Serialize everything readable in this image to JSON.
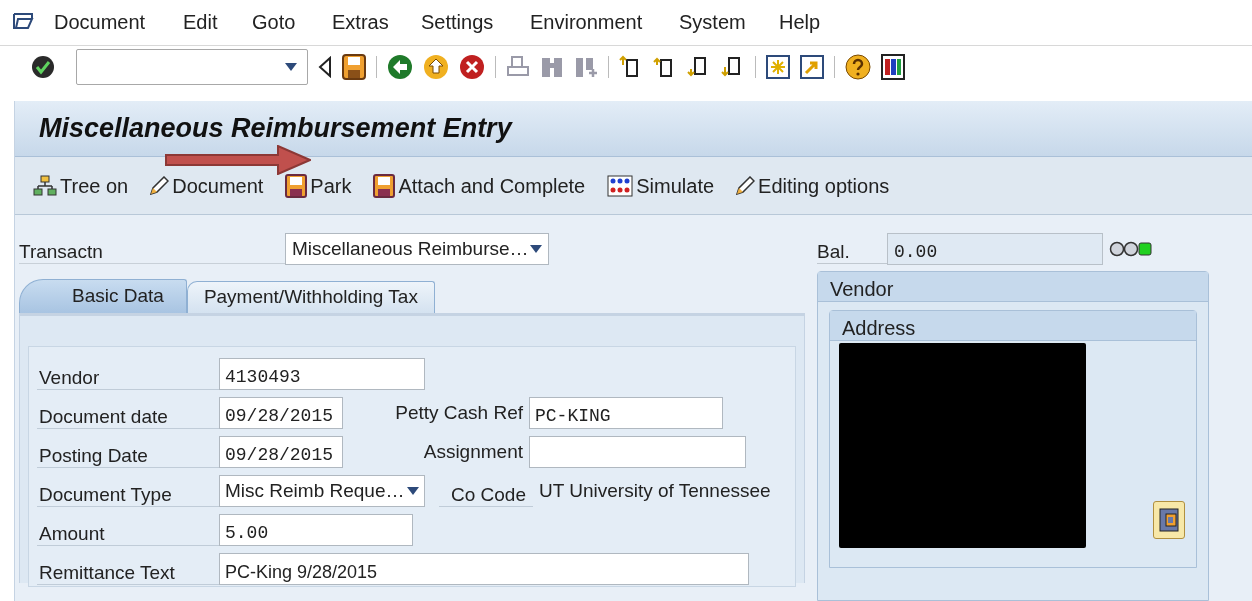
{
  "menu": [
    "Document",
    "Edit",
    "Goto",
    "Extras",
    "Settings",
    "Environment",
    "System",
    "Help"
  ],
  "title": "Miscellaneous Reimbursement Entry",
  "app_toolbar": [
    {
      "kind": "tree",
      "label": "Tree on"
    },
    {
      "kind": "edit",
      "label": "Document"
    },
    {
      "kind": "save",
      "label": "Park"
    },
    {
      "kind": "save",
      "label": "Attach and Complete"
    },
    {
      "kind": "simulate",
      "label": "Simulate"
    },
    {
      "kind": "edit",
      "label": "Editing options"
    }
  ],
  "transaction": {
    "label": "Transactn",
    "value": "Miscellaneous Reimburse…"
  },
  "tabs": [
    {
      "label": "Basic Data",
      "selected": true
    },
    {
      "label": "Payment/Withholding Tax",
      "selected": false
    }
  ],
  "rows": [
    {
      "label": "Vendor",
      "kind": "text",
      "value": "4130493"
    },
    {
      "label": "Document date",
      "kind": "date",
      "value": "09/28/2015",
      "side": {
        "kind": "field",
        "label": "Petty Cash Ref",
        "value": "PC-KING"
      }
    },
    {
      "label": "Posting Date",
      "kind": "date",
      "value": "09/28/2015",
      "side": {
        "kind": "field",
        "label": "Assignment"
      }
    },
    {
      "label": "Document Type",
      "kind": "dropdown",
      "value": "Misc Reimb Reque…",
      "side": {
        "kind": "display",
        "label": "Co Code",
        "value": "UT University of Tennessee"
      }
    },
    {
      "label": "Amount",
      "kind": "amount",
      "value": "5.00"
    },
    {
      "label": "Remittance Text",
      "kind": "long",
      "value": "PC-King 9/28/2015"
    }
  ],
  "balance": {
    "label": "Bal.",
    "value": "0.00",
    "lights": [
      {
        "on": false
      },
      {
        "on": false
      },
      {
        "on": true
      }
    ]
  },
  "vendor_panel": {
    "title": "Vendor",
    "address_title": "Address"
  }
}
